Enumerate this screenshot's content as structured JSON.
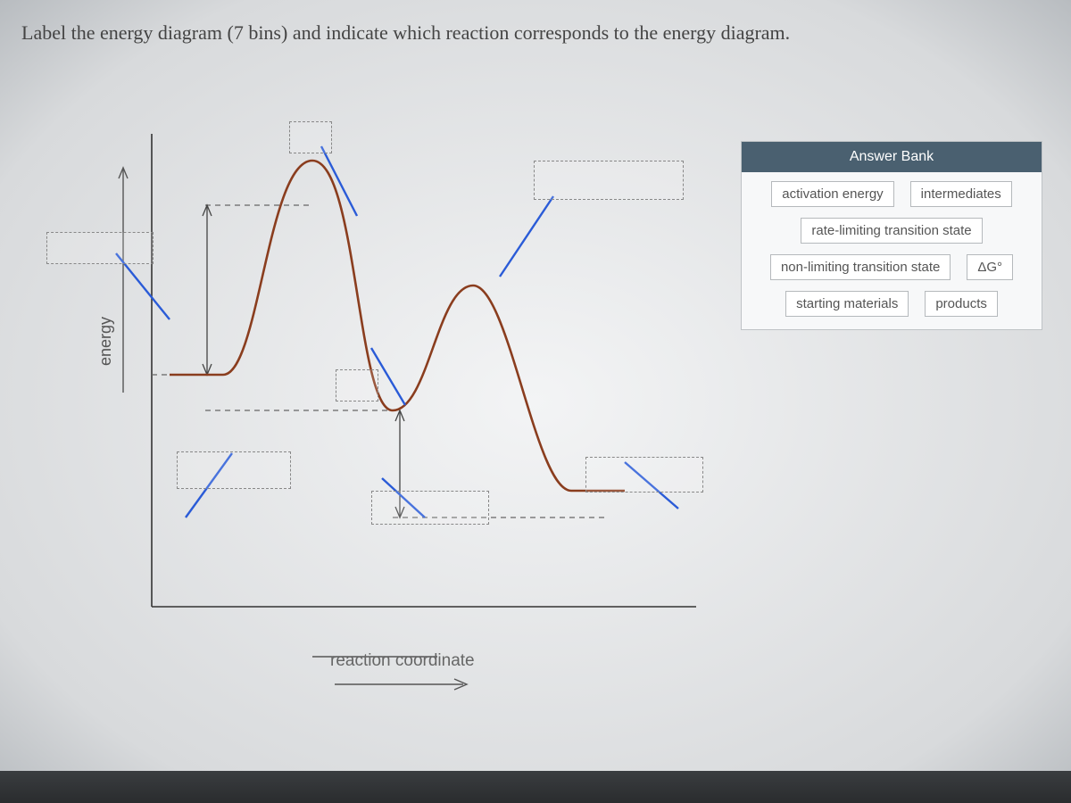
{
  "prompt": "Label the energy diagram (7 bins) and indicate which reaction corresponds to the energy diagram.",
  "axes": {
    "y_label": "energy",
    "x_label": "reaction coordinate"
  },
  "answer_bank": {
    "title": "Answer Bank",
    "chips": [
      "activation energy",
      "intermediates",
      "rate-limiting transition state",
      "non-limiting transition state",
      "ΔG°",
      "starting materials",
      "products"
    ]
  },
  "chart_data": {
    "type": "line",
    "title": "Reaction energy diagram",
    "xlabel": "reaction coordinate",
    "ylabel": "energy",
    "x": [
      0,
      0.12,
      0.28,
      0.4,
      0.55,
      0.68,
      0.95
    ],
    "values": [
      60,
      60,
      100,
      40,
      72,
      10,
      10
    ],
    "ylim": [
      0,
      110
    ],
    "annotations": [
      {
        "kind": "vertical-span",
        "x": 0.12,
        "y_from": 60,
        "y_to": 100,
        "label_slot": "activation energy"
      },
      {
        "kind": "vertical-span",
        "x": 0.4,
        "y_from": 10,
        "y_to": 40,
        "label_slot": "ΔG° / intermediates region"
      },
      {
        "kind": "drop-slot",
        "near": "left-of-start",
        "label_slot": "starting materials"
      },
      {
        "kind": "drop-slot",
        "near": "first-peak",
        "label_slot": "rate-limiting transition state"
      },
      {
        "kind": "drop-slot",
        "near": "valley",
        "label_slot": "intermediates"
      },
      {
        "kind": "drop-slot",
        "near": "second-peak",
        "label_slot": "non-limiting transition state"
      },
      {
        "kind": "drop-slot",
        "near": "right-end",
        "label_slot": "products"
      }
    ]
  }
}
